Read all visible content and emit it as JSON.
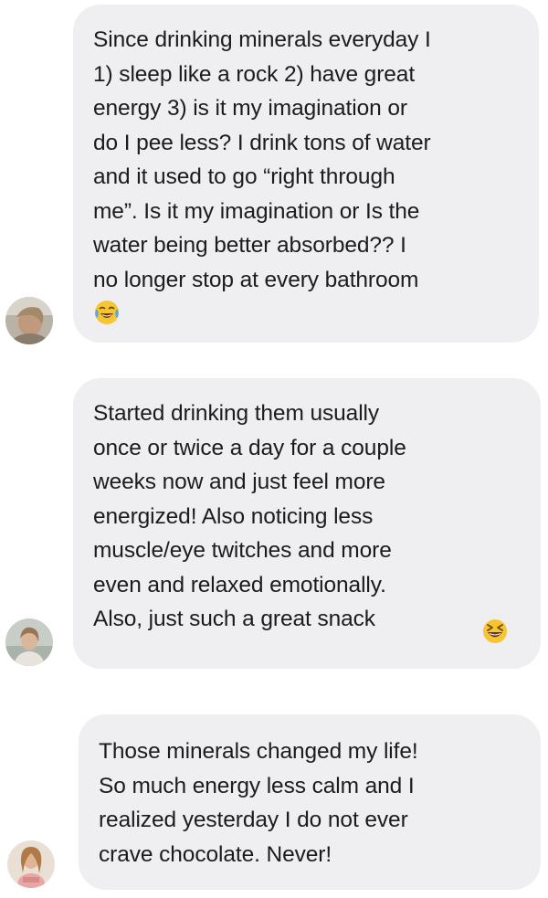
{
  "messages": [
    {
      "text": "Since drinking minerals everyday I\n1) sleep like a rock 2) have great\nenergy 3) is it my imagination or\ndo I pee less? I drink tons of water\nand it used to go “right through\nme”. Is it my imagination or Is the\nwater being better absorbed?? I\nno longer stop at every bathroom",
      "emoji": "face-with-tears-of-joy-emoji"
    },
    {
      "text": "Started drinking them usually\nonce or twice a day for a couple\nweeks now and just feel more\nenergized! Also noticing less\nmuscle/eye twitches and more\neven and relaxed emotionally.\nAlso, just such a great snack",
      "emoji": "laughing-squinting-face-emoji"
    },
    {
      "text": "Those minerals changed my life!\nSo much energy less calm and I\nrealized yesterday I do not ever\ncrave chocolate. Never!",
      "emoji": ""
    }
  ],
  "colors": {
    "background": "#ffffff",
    "bubble": "#efeff1",
    "text": "#1c1c1e",
    "emoji_face": "#f7c531",
    "emoji_tears": "#5aa9e6"
  }
}
